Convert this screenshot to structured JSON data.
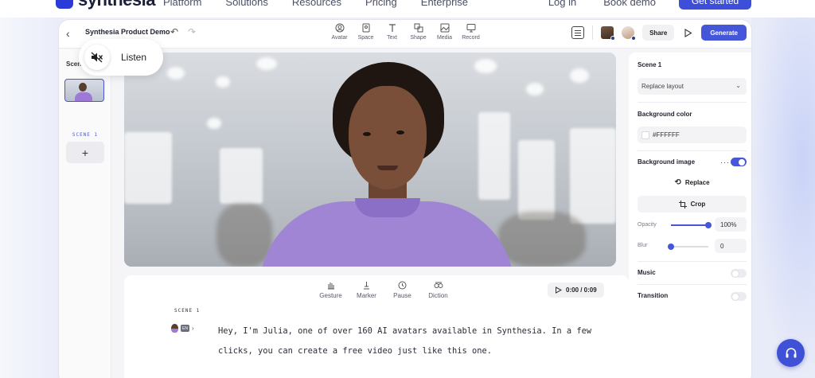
{
  "site": {
    "logo_text": "synthesia",
    "nav_links": [
      "Platform",
      "Solutions",
      "Resources",
      "Pricing",
      "Enterprise"
    ],
    "login": "Log in",
    "book_demo": "Book demo",
    "cta": "Get started"
  },
  "toolbar": {
    "title": "Synthesia Product Demo",
    "tools": [
      {
        "label": "Avatar",
        "icon": "avatar-icon"
      },
      {
        "label": "Space",
        "icon": "space-icon"
      },
      {
        "label": "Text",
        "icon": "text-icon"
      },
      {
        "label": "Shape",
        "icon": "shape-icon"
      },
      {
        "label": "Media",
        "icon": "media-icon"
      },
      {
        "label": "Record",
        "icon": "record-icon"
      }
    ],
    "share": "Share",
    "generate": "Generate"
  },
  "scenes": {
    "label": "Scenes",
    "items": [
      {
        "caption": "SCENE 1"
      }
    ],
    "add": "+"
  },
  "listen": {
    "label": "Listen"
  },
  "script_panel": {
    "tools": [
      {
        "label": "Gesture",
        "icon": "gesture-icon"
      },
      {
        "label": "Marker",
        "icon": "marker-icon"
      },
      {
        "label": "Pause",
        "icon": "pause-icon"
      },
      {
        "label": "Diction",
        "icon": "diction-icon"
      }
    ],
    "timer": "0:00 / 0:09",
    "scene_label": "SCENE 1",
    "lang": "EN",
    "text": "Hey, I'm Julia, one of over 160 AI avatars available in Synthesia. In a few clicks, you can create a free video just like this one."
  },
  "properties": {
    "title": "Scene 1",
    "layout": "Replace layout",
    "background_color_label": "Background color",
    "background_color_value": "#FFFFFF",
    "background_image_label": "Background image",
    "background_image_on": true,
    "replace": "Replace",
    "crop": "Crop",
    "opacity_label": "Opacity",
    "opacity_value": "100%",
    "opacity_fraction": 1.0,
    "blur_label": "Blur",
    "blur_value": "0",
    "blur_fraction": 0.0,
    "music_label": "Music",
    "music_on": false,
    "transition_label": "Transition",
    "transition_on": false
  },
  "colors": {
    "accent": "#4656d9",
    "sweater": "#9f85d4"
  }
}
